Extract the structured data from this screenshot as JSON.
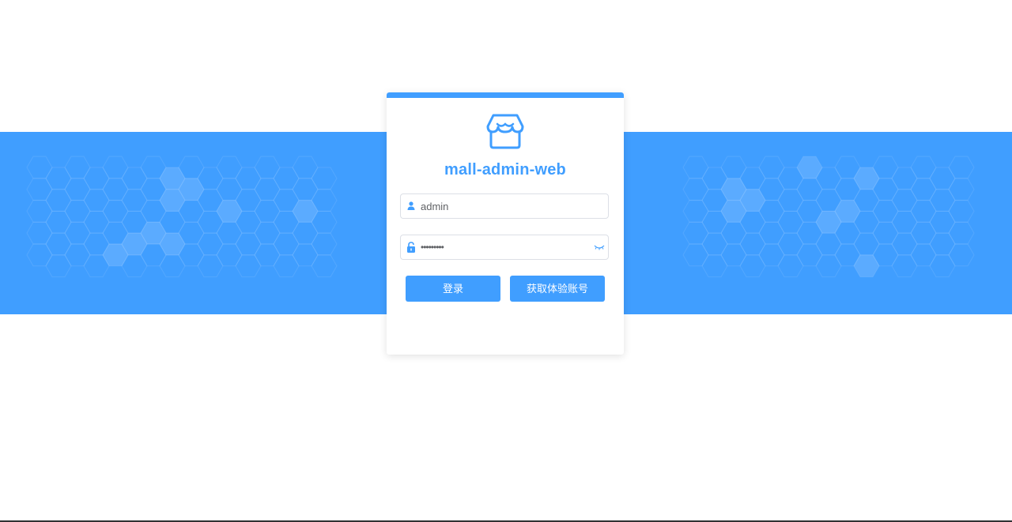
{
  "app": {
    "title": "mall-admin-web",
    "logo_icon": "store-icon"
  },
  "login_form": {
    "username_value": "admin",
    "username_icon": "user-icon",
    "password_value": "•••••••••",
    "password_icon": "lock-icon",
    "password_toggle_icon": "eye-closed-icon",
    "login_button": "登录",
    "trial_account_button": "获取体验账号"
  },
  "colors": {
    "primary": "#409eff",
    "banner": "#409eff",
    "input_border": "#dcdfe6",
    "text": "#606266"
  }
}
